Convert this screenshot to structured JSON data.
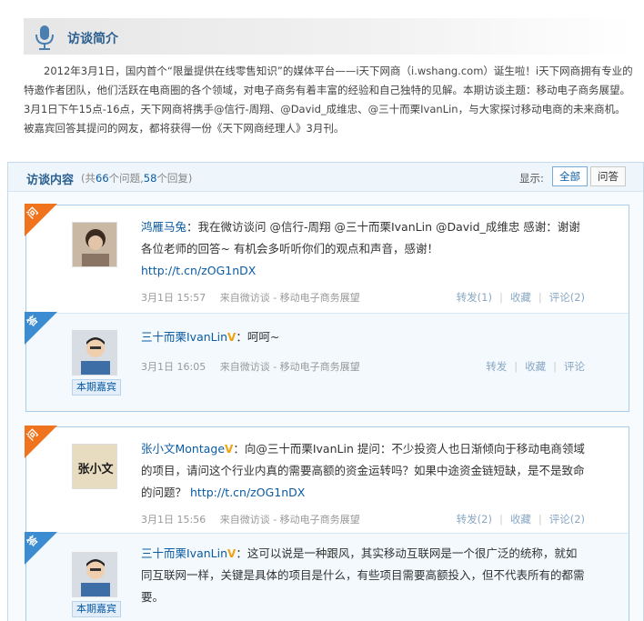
{
  "intro": {
    "title": "访谈简介",
    "text": "2012年3月1日，国内首个“限量提供在线零售知识”的媒体平台——i天下网商（i.wshang.com）诞生啦！i天下网商拥有专业的特邀作者团队，他们活跃在电商圈的各个领域，对电子商务有着丰富的经验和自己独特的见解。本期访谈主题：移动电子商务展望。3月1日下午15点-16点，天下网商将携手@信行-周翔、@David_成维忠、@三十而栗IvanLin，与大家探讨移动电商的未来商机。被嘉宾回答其提问的网友，都将获得一份《天下网商经理人》3月刊。"
  },
  "interview": {
    "title": "访谈内容",
    "count_prefix": "(共",
    "question_count": "66",
    "count_mid": "个问题,",
    "answer_count": "58",
    "count_suffix": "个回复)",
    "display_label": "显示:",
    "filters": [
      "全部",
      "问答"
    ],
    "active_filter": "全部"
  },
  "threads": [
    {
      "question": {
        "corner": "问",
        "author": "鸿雁马兔",
        "text": "：我在微访谈问 @信行-周翔 @三十而栗IvanLin @David_成维忠 感谢：谢谢各位老师的回答~ 有机会多听听你们的观点和声音，感谢！",
        "link": "http://t.cn/zOG1nDX",
        "time": "3月1日 15:57",
        "source": "来自微访谈 - 移动电子商务展望",
        "repost": "转发(1)",
        "favorite": "收藏",
        "comment": "评论(2)"
      },
      "answer": {
        "corner": "答",
        "author": "三十而栗IvanLin",
        "verified": "V",
        "badge": "本期嘉宾",
        "text": "：呵呵~",
        "time": "3月1日 16:05",
        "source": "来自微访谈 - 移动电子商务展望",
        "repost": "转发",
        "favorite": "收藏",
        "comment": "评论"
      }
    },
    {
      "question": {
        "corner": "问",
        "author": "张小文Montage",
        "verified": "V",
        "text": "：向@三十而栗IvanLin 提问：不少投资人也日渐倾向于移动电商领域的项目，请问这个行业内真的需要高额的资金运转吗？如果中途资金链短缺，是不是致命的问题？",
        "link": "http://t.cn/zOG1nDX",
        "avatar_text": "张小文",
        "time": "3月1日 15:56",
        "source": "来自微访谈 - 移动电子商务展望",
        "repost": "转发(2)",
        "favorite": "收藏",
        "comment": "评论(2)"
      },
      "answer": {
        "corner": "答",
        "author": "三十而栗IvanLin",
        "verified": "V",
        "badge": "本期嘉宾",
        "text": "：这可以说是一种跟风，其实移动互联网是一个很广泛的统称，就如同互联网一样，关键是具体的项目是什么，有些项目需要高额投入，但不代表所有的都需要。"
      }
    }
  ],
  "colors": {
    "accent": "#0a5ba3",
    "question_corner": "#f0731e",
    "answer_corner": "#3c8cd2",
    "verified": "#f0a20e"
  }
}
